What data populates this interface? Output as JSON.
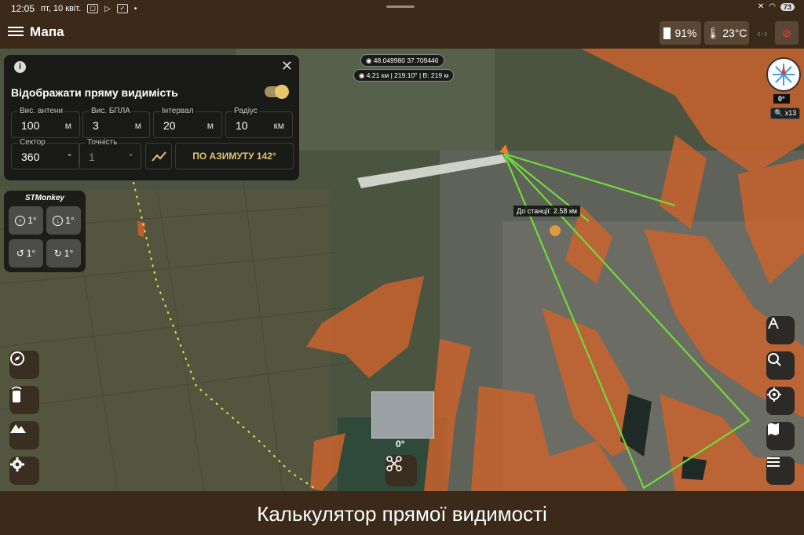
{
  "status_bar": {
    "time": "12:05",
    "date": "пт, 10 квіт.",
    "battery_level": "73"
  },
  "app_bar": {
    "title": "Мапа",
    "battery": "91%",
    "temperature": "23°C",
    "link_icon": "arrows-horizontal-icon",
    "no_signal_icon": "signal-off-icon"
  },
  "los_panel": {
    "title": "Відображати пряму видимість",
    "toggle_on": true,
    "fields": {
      "antenna_height": {
        "label": "Вис. антени",
        "value": "100",
        "unit": "м"
      },
      "uav_height": {
        "label": "Вис. БПЛА",
        "value": "3",
        "unit": "м"
      },
      "interval": {
        "label": "Інтервал",
        "value": "20",
        "unit": "м"
      },
      "radius": {
        "label": "Радіус",
        "value": "10",
        "unit": "км"
      },
      "sector": {
        "label": "Сектор",
        "value": "360",
        "unit": "°"
      },
      "accuracy": {
        "label": "Точність",
        "value": "1",
        "unit": "°"
      }
    },
    "azimuth_button": "ПО АЗИМУТУ 142°"
  },
  "stmonkey": {
    "title": "STMonkey",
    "up": "1°",
    "down": "1°",
    "rotate_left": "1°",
    "rotate_right": "1°"
  },
  "map": {
    "coordinates": "48.049980 37.709446",
    "measure": "4.21 км | 219.10° | В: 219 м",
    "distance_label": "До станції: 2.58 км",
    "compass_heading": "0°",
    "zoom": "x13",
    "drone_heading": "0°",
    "colors": {
      "los_sector": "#6fdc3a",
      "shadow_zone": "#c9632e",
      "accent": "#e3c46f",
      "route": "#e8e04a"
    }
  },
  "caption": "Калькулятор прямої видимості"
}
